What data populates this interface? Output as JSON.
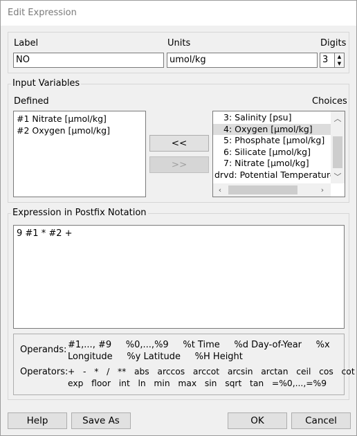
{
  "window": {
    "title": "Edit Expression"
  },
  "header": {
    "label_caption": "Label",
    "label_value": "NO",
    "units_caption": "Units",
    "units_value": "umol/kg",
    "digits_caption": "Digits",
    "digits_value": "3"
  },
  "input_vars": {
    "group_title": "Input Variables",
    "defined_caption": "Defined",
    "choices_caption": "Choices",
    "defined": [
      "#1 Nitrate [µmol/kg]",
      "#2 Oxygen [µmol/kg]"
    ],
    "choices": [
      "3: Salinity [psu]",
      "4: Oxygen [µmol/kg]",
      "5: Phosphate [µmol/kg]",
      "6: Silicate [µmol/kg]",
      "7: Nitrate [µmol/kg]",
      "drvd: Potential Temperature €"
    ],
    "selected_choice": "4: Oxygen [µmol/kg]",
    "add_button": "<<",
    "remove_button": ">>"
  },
  "expression": {
    "group_title": "Expression in Postfix Notation",
    "value": "9 #1 * #2 +",
    "operands_caption": "Operands:",
    "operands_line1": "#1,..., #9     %0,...,%9     %t Time     %d Day-of-Year     %x",
    "operands_line2": "Longitude     %y Latitude     %H Height",
    "operators_caption": "Operators:",
    "operators_line1": "+   -   *   /   **   abs   arccos   arccot   arcsin   arctan   ceil   cos   cot",
    "operators_line2": "exp   floor   int   ln   min   max   sin   sqrt   tan   =%0,...,=%9"
  },
  "footer": {
    "help": "Help",
    "save_as": "Save As",
    "ok": "OK",
    "cancel": "Cancel"
  }
}
